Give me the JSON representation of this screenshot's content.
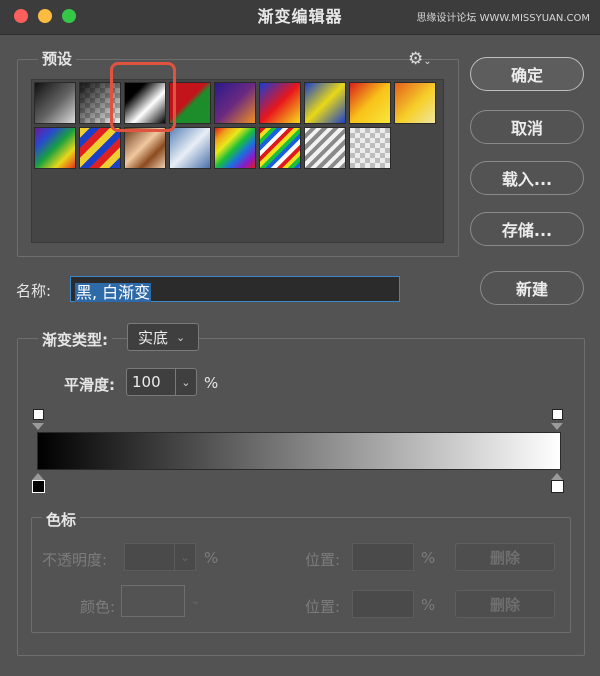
{
  "window": {
    "title": "渐变编辑器",
    "watermark": "思缘设计论坛 WWW.MISSYUAN.COM"
  },
  "presets": {
    "label": "预设",
    "gear_glyph": "⚙",
    "menu_glyph": "⌄"
  },
  "buttons": {
    "ok": "确定",
    "cancel": "取消",
    "load": "载入...",
    "save": "存储...",
    "new": "新建",
    "delete_opacity": "删除",
    "delete_color": "删除"
  },
  "name": {
    "label": "名称:",
    "value": "黑, 白渐变"
  },
  "gradient": {
    "type_label": "渐变类型:",
    "type_value": "实底",
    "smoothness_label": "平滑度:",
    "smoothness_value": "100",
    "smoothness_unit": "%"
  },
  "stops": {
    "legend": "色标",
    "opacity_label": "不透明度:",
    "opacity_unit": "%",
    "opacity_location_label": "位置:",
    "opacity_location_unit": "%",
    "color_label": "颜色:",
    "color_location_label": "位置:",
    "color_location_unit": "%"
  },
  "colors": {
    "close": "#fc605c",
    "minimize": "#fdbc40",
    "maximize": "#34c749",
    "highlight": "#e0533f",
    "input_border": "#3b86c6"
  }
}
